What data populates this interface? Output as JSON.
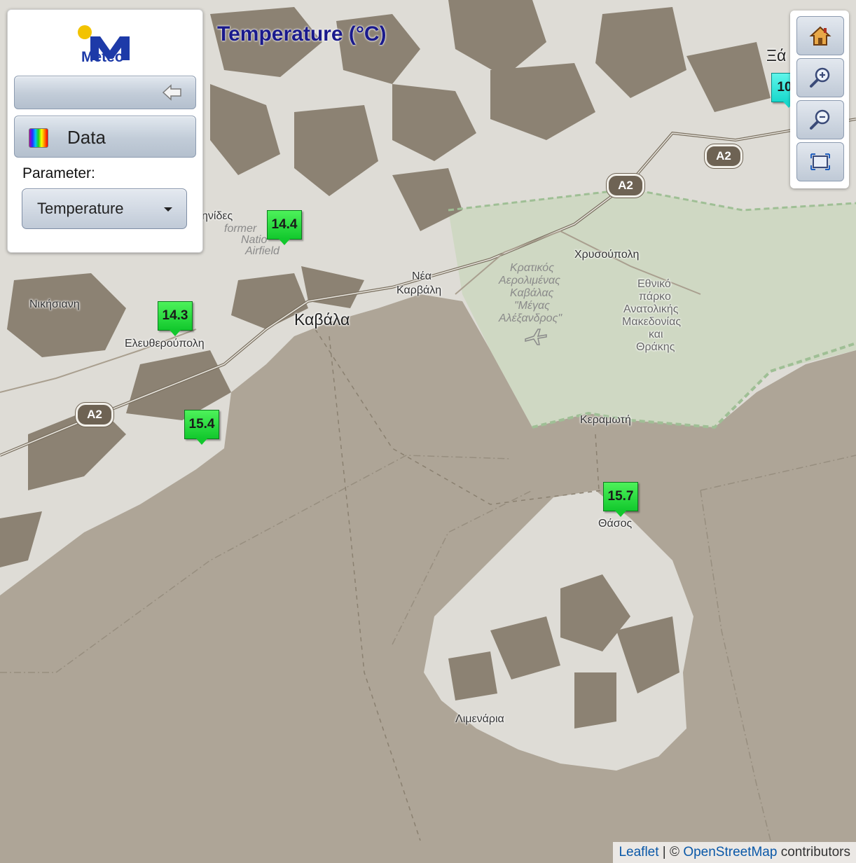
{
  "header": {
    "title": "Temperature (°C)"
  },
  "panel": {
    "logo_text": "Meteo",
    "data_button_label": "Data",
    "parameter_label": "Parameter:",
    "parameter_select_value": "Temperature"
  },
  "toolbar": {
    "buttons": [
      "home-icon",
      "zoom-in-icon",
      "zoom-out-icon",
      "fit-extent-icon"
    ]
  },
  "stations": [
    {
      "value": "14.4",
      "color": "#2fe04a"
    },
    {
      "value": "14.3",
      "color": "#2fe04a"
    },
    {
      "value": "15.4",
      "color": "#2fe04a"
    },
    {
      "value": "15.7",
      "color": "#2fe04a"
    },
    {
      "value": "10",
      "color": "#2fe0d4"
    }
  ],
  "places": {
    "kavala": "Καβάλα",
    "nea_karvali_1": "Νέα",
    "nea_karvali_2": "Καρβάλη",
    "chrysoupoli": "Χρυσούπολη",
    "nikisiani": "Νικήσιανη",
    "eleftheroupoli": "Ελευθερούπολη",
    "keramoti": "Κεραμωτή",
    "thasos": "Θάσος",
    "limenaria": "Λιμενάρια",
    "xanthi_partial": "Ξά",
    "ni_partial": "ηνίδες",
    "former_1": "former",
    "former_2": "Natio",
    "former_3": "Airfield",
    "airport_1": "Κρατικός",
    "airport_2": "Αερολιμένας",
    "airport_3": "Καβάλας",
    "airport_4": "\"Μέγας",
    "airport_5": "Αλέξανδρος\"",
    "park_1": "Εθνικό",
    "park_2": "πάρκο",
    "park_3": "Ανατολικής",
    "park_4": "Μακεδονίας",
    "park_5": "και",
    "park_6": "Θράκης"
  },
  "roads": {
    "a2": "A2"
  },
  "attribution": {
    "leaflet": "Leaflet",
    "sep": " | © ",
    "osm": "OpenStreetMap",
    "contributors": " contributors"
  },
  "colors": {
    "sea": "#aea597",
    "land": "#dedcd6",
    "forest": "#8c8273",
    "park": "#c9d4bd",
    "title": "#1a1a8c"
  }
}
